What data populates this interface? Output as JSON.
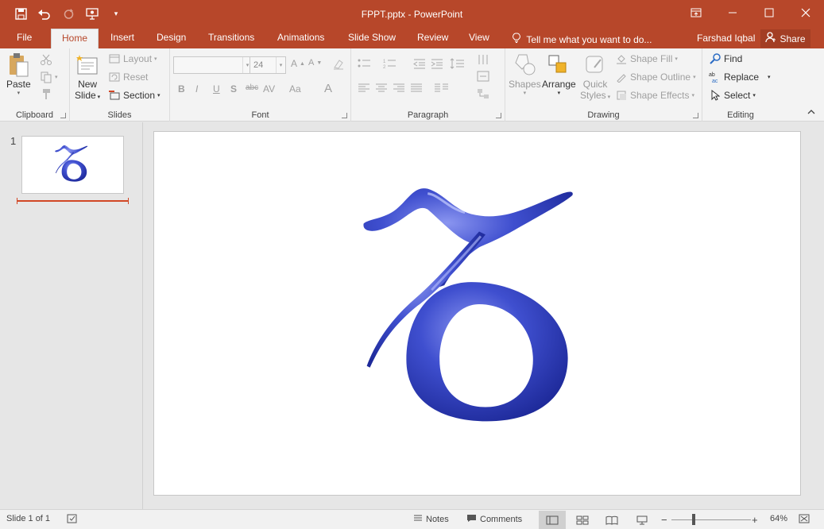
{
  "window": {
    "title": "FPPT.pptx - PowerPoint"
  },
  "tabs": [
    {
      "label": "File"
    },
    {
      "label": "Home"
    },
    {
      "label": "Insert"
    },
    {
      "label": "Design"
    },
    {
      "label": "Transitions"
    },
    {
      "label": "Animations"
    },
    {
      "label": "Slide Show"
    },
    {
      "label": "Review"
    },
    {
      "label": "View"
    }
  ],
  "tell_me": "Tell me what you want to do...",
  "user": "Farshad Iqbal",
  "share_label": "Share",
  "ribbon": {
    "clipboard": {
      "label": "Clipboard",
      "paste": "Paste"
    },
    "slides": {
      "label": "Slides",
      "new_slide_1": "New",
      "new_slide_2": "Slide",
      "layout": "Layout",
      "reset": "Reset",
      "section": "Section"
    },
    "font": {
      "label": "Font",
      "size": "24",
      "buttons": [
        "B",
        "I",
        "U",
        "S",
        "abc",
        "AV",
        "Aa",
        "A"
      ]
    },
    "paragraph": {
      "label": "Paragraph"
    },
    "drawing": {
      "label": "Drawing",
      "shapes": "Shapes",
      "arrange": "Arrange",
      "quick_styles_1": "Quick",
      "quick_styles_2": "Styles",
      "shape_fill": "Shape Fill",
      "shape_outline": "Shape Outline",
      "shape_effects": "Shape Effects"
    },
    "editing": {
      "label": "Editing",
      "find": "Find",
      "replace": "Replace",
      "select": "Select"
    }
  },
  "slides_pane": {
    "slide_number": "1"
  },
  "status": {
    "slide_info": "Slide 1 of 1",
    "notes": "Notes",
    "comments": "Comments",
    "zoom": "64%"
  },
  "colors": {
    "accent": "#b7472a",
    "glyph": "#3a48c0"
  }
}
